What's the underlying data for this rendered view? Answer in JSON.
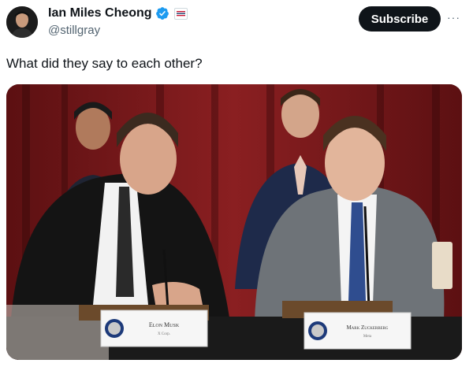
{
  "author": {
    "name": "Ian Miles Cheong",
    "handle": "@stillgray",
    "verified_icon": "verified-badge-icon",
    "affiliation_icon": "affiliation-flag-icon"
  },
  "actions": {
    "subscribe_label": "Subscribe",
    "more_label": "···"
  },
  "tweet": {
    "text": "What did they say to each other?"
  },
  "media": {
    "placard_left": {
      "name": "Elon Musk",
      "sub": "X Corp."
    },
    "placard_right": {
      "name": "Mark Zuckerberg",
      "sub": "Meta"
    }
  },
  "colors": {
    "subscribe_bg": "#0f1419",
    "verified_blue": "#1d9bf0",
    "curtain_red": "#7a1a1c"
  }
}
